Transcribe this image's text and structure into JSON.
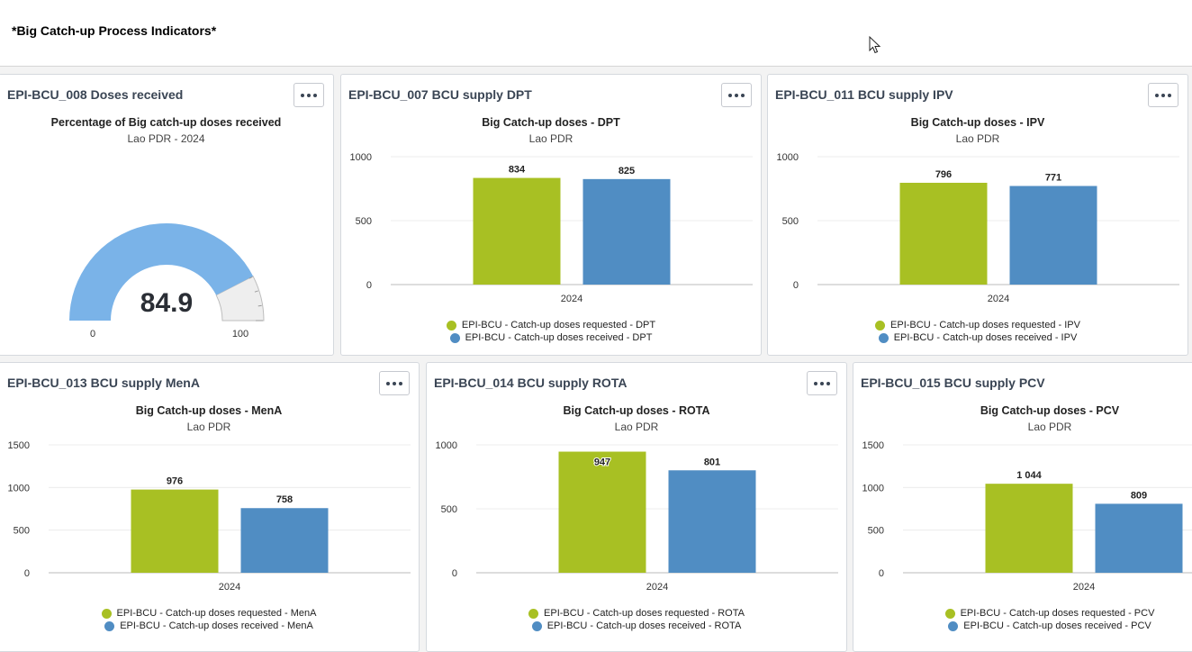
{
  "page": {
    "title": "*Big Catch-up Process Indicators*"
  },
  "colors": {
    "requested": "#a8c023",
    "received": "#508dc3",
    "gauge_fill": "#7ab3e8",
    "gauge_track": "#eeeeee"
  },
  "gauge_card": {
    "title": "EPI-BCU_008 Doses received",
    "chart_title": "Percentage of Big catch-up doses received",
    "chart_subtitle": "Lao PDR - 2024",
    "value_label": "84.9",
    "min_label": "0",
    "max_label": "100",
    "chart_data": {
      "type": "gauge",
      "value": 84.9,
      "min": 0,
      "max": 100
    }
  },
  "bar_cards": [
    {
      "title": "EPI-BCU_007 BCU supply DPT",
      "chart_title": "Big Catch-up doses - DPT",
      "chart_subtitle": "Lao PDR",
      "legend": [
        "EPI-BCU - Catch-up doses requested - DPT",
        "EPI-BCU - Catch-up doses received - DPT"
      ],
      "chart_data": {
        "type": "bar",
        "categories": [
          "2024"
        ],
        "series": [
          {
            "name": "EPI-BCU - Catch-up doses requested - DPT",
            "values": [
              834
            ],
            "labels": [
              "834"
            ]
          },
          {
            "name": "EPI-BCU - Catch-up doses received - DPT",
            "values": [
              825
            ],
            "labels": [
              "825"
            ]
          }
        ],
        "yticks": [
          "0",
          "500",
          "1000"
        ],
        "ylim": [
          0,
          1000
        ]
      }
    },
    {
      "title": "EPI-BCU_011 BCU supply IPV",
      "chart_title": "Big Catch-up doses - IPV",
      "chart_subtitle": "Lao PDR",
      "legend": [
        "EPI-BCU - Catch-up doses requested - IPV",
        "EPI-BCU - Catch-up doses received - IPV"
      ],
      "chart_data": {
        "type": "bar",
        "categories": [
          "2024"
        ],
        "series": [
          {
            "name": "EPI-BCU - Catch-up doses requested - IPV",
            "values": [
              796
            ],
            "labels": [
              "796"
            ]
          },
          {
            "name": "EPI-BCU - Catch-up doses received - IPV",
            "values": [
              771
            ],
            "labels": [
              "771"
            ]
          }
        ],
        "yticks": [
          "0",
          "500",
          "1000"
        ],
        "ylim": [
          0,
          1000
        ]
      }
    },
    {
      "title": "EPI-BCU_013 BCU supply MenA",
      "chart_title": "Big Catch-up doses - MenA",
      "chart_subtitle": "Lao PDR",
      "legend": [
        "EPI-BCU - Catch-up doses requested - MenA",
        "EPI-BCU - Catch-up doses received - MenA"
      ],
      "chart_data": {
        "type": "bar",
        "categories": [
          "2024"
        ],
        "series": [
          {
            "name": "EPI-BCU - Catch-up doses requested - MenA",
            "values": [
              976
            ],
            "labels": [
              "976"
            ]
          },
          {
            "name": "EPI-BCU - Catch-up doses received - MenA",
            "values": [
              758
            ],
            "labels": [
              "758"
            ]
          }
        ],
        "yticks": [
          "0",
          "500",
          "1000",
          "1500"
        ],
        "ylim": [
          0,
          1500
        ]
      }
    },
    {
      "title": "EPI-BCU_014 BCU supply ROTA",
      "chart_title": "Big Catch-up doses - ROTA",
      "chart_subtitle": "Lao PDR",
      "legend": [
        "EPI-BCU - Catch-up doses requested - ROTA",
        "EPI-BCU - Catch-up doses received - ROTA"
      ],
      "chart_data": {
        "type": "bar",
        "categories": [
          "2024"
        ],
        "series": [
          {
            "name": "EPI-BCU - Catch-up doses requested - ROTA",
            "values": [
              947
            ],
            "labels": [
              "947"
            ]
          },
          {
            "name": "EPI-BCU - Catch-up doses received - ROTA",
            "values": [
              801
            ],
            "labels": [
              "801"
            ]
          }
        ],
        "yticks": [
          "0",
          "500",
          "1000"
        ],
        "ylim": [
          0,
          1000
        ]
      }
    },
    {
      "title": "EPI-BCU_015 BCU supply PCV",
      "chart_title": "Big Catch-up doses - PCV",
      "chart_subtitle": "Lao PDR",
      "legend": [
        "EPI-BCU - Catch-up doses requested - PCV",
        "EPI-BCU - Catch-up doses received - PCV"
      ],
      "chart_data": {
        "type": "bar",
        "categories": [
          "2024"
        ],
        "series": [
          {
            "name": "EPI-BCU - Catch-up doses requested - PCV",
            "values": [
              1044
            ],
            "labels": [
              "1 044"
            ]
          },
          {
            "name": "EPI-BCU - Catch-up doses received - PCV",
            "values": [
              809
            ],
            "labels": [
              "809"
            ]
          }
        ],
        "yticks": [
          "0",
          "500",
          "1000",
          "1500"
        ],
        "ylim": [
          0,
          1500
        ]
      }
    }
  ]
}
